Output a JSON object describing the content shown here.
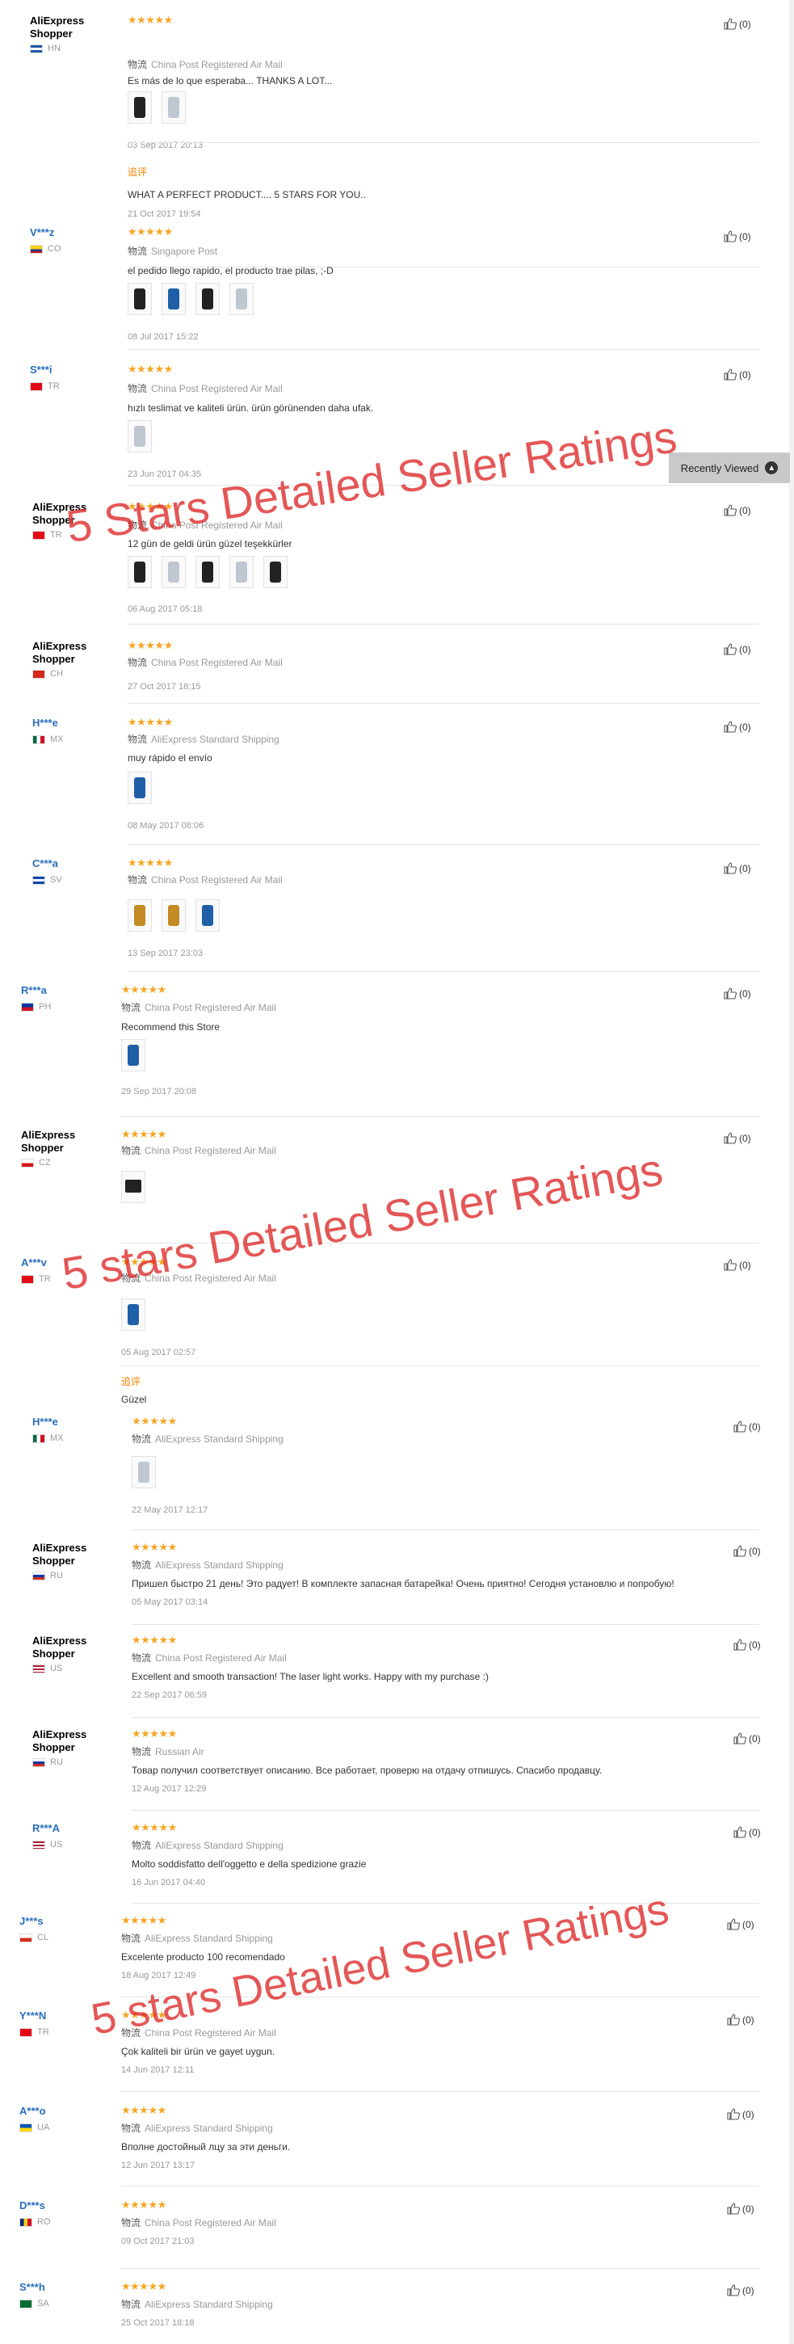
{
  "helpful_icon": "thumbs-up-icon",
  "star_glyph": "★★★★★",
  "recently_viewed": {
    "label": "Recently Viewed",
    "icon": "chevron-up-icon"
  },
  "watermarks": [
    {
      "text": "5 Stars Detailed Seller Ratings"
    },
    {
      "text": "5 stars Detailed Seller Ratings"
    },
    {
      "text": "5 stars Detailed Seller Ratings"
    }
  ],
  "reviews": [
    {
      "user": "AliExpress Shopper",
      "country": "HN",
      "flag": "hn",
      "stars": 5,
      "ship_zh": "物流",
      "shipping": "China Post Registered Air Mail",
      "text": "Es más de lo que esperaba... THANKS A LOT...",
      "photos": 2,
      "date": "03 Sep 2017 20:13",
      "helpful": "(0)",
      "followup_label": "追评",
      "followup_text": "WHAT A PERFECT PRODUCT.... 5 STARS FOR YOU..",
      "followup_date": "21 Oct 2017 19:54"
    },
    {
      "user": "V***z",
      "country": "CO",
      "flag": "co",
      "stars": 5,
      "ship_zh": "物流",
      "shipping": "Singapore Post",
      "text": "el pedido llego rapido, el producto trae pilas, ;-D",
      "photos": 4,
      "date": "08 Jul 2017 15:22",
      "helpful": "(0)"
    },
    {
      "user": "S***i",
      "country": "TR",
      "flag": "tr",
      "stars": 5,
      "ship_zh": "物流",
      "shipping": "China Post Registered Air Mail",
      "text": "hızlı teslimat ve kaliteli ürün. ürün görünenden daha ufak.",
      "photos": 1,
      "date": "23 Jun 2017 04:35",
      "helpful": "(0)"
    },
    {
      "user": "AliExpress Shopper",
      "country": "TR",
      "flag": "tr",
      "stars": 5,
      "ship_zh": "物流",
      "shipping": "China Post Registered Air Mail",
      "text": "12 gün de geldi ürün güzel teşekkürler",
      "photos": 5,
      "date": "06 Aug 2017 05:18",
      "helpful": "(0)"
    },
    {
      "user": "AliExpress Shopper",
      "country": "CH",
      "flag": "ch",
      "stars": 5,
      "ship_zh": "物流",
      "shipping": "China Post Registered Air Mail",
      "text": "",
      "photos": 0,
      "date": "27 Oct 2017 18:15",
      "helpful": "(0)"
    },
    {
      "user": "H***e",
      "country": "MX",
      "flag": "mx",
      "stars": 5,
      "ship_zh": "物流",
      "shipping": "AliExpress Standard Shipping",
      "text": "muy rápido el envío",
      "photos": 1,
      "date": "08 May 2017 08:06",
      "helpful": "(0)"
    },
    {
      "user": "C***a",
      "country": "SV",
      "flag": "sv",
      "stars": 5,
      "ship_zh": "物流",
      "shipping": "China Post Registered Air Mail",
      "text": "",
      "photos": 3,
      "date": "13 Sep 2017 23:03",
      "helpful": "(0)"
    },
    {
      "user": "R***a",
      "country": "PH",
      "flag": "ph",
      "stars": 5,
      "ship_zh": "物流",
      "shipping": "China Post Registered Air Mail",
      "text": "Recommend this Store",
      "photos": 1,
      "date": "29 Sep 2017 20:08",
      "helpful": "(0)"
    },
    {
      "user": "AliExpress Shopper",
      "country": "CZ",
      "flag": "cz",
      "stars": 5,
      "ship_zh": "物流",
      "shipping": "China Post Registered Air Mail",
      "text": "",
      "photos": 1,
      "date": "",
      "helpful": "(0)"
    },
    {
      "user": "A***v",
      "country": "TR",
      "flag": "tr",
      "stars": 5,
      "ship_zh": "物流",
      "shipping": "China Post Registered Air Mail",
      "text": "",
      "photos": 1,
      "date": "05 Aug 2017 02:57",
      "helpful": "(0)",
      "followup_label": "追评",
      "followup_text": "Güzel",
      "followup_date": ""
    },
    {
      "user": "H***e",
      "country": "MX",
      "flag": "mx",
      "stars": 5,
      "ship_zh": "物流",
      "shipping": "AliExpress Standard Shipping",
      "text": "",
      "photos": 1,
      "date": "22 May 2017 12:17",
      "helpful": "(0)"
    },
    {
      "user": "AliExpress Shopper",
      "country": "RU",
      "flag": "ru",
      "stars": 5,
      "ship_zh": "物流",
      "shipping": "AliExpress Standard Shipping",
      "text": "Пришел быстро 21 день! Это радует! В комплекте запасная батарейка! Очень приятно! Сегодня установлю и попробую!",
      "photos": 0,
      "date": "05 May 2017 03:14",
      "helpful": "(0)"
    },
    {
      "user": "AliExpress Shopper",
      "country": "US",
      "flag": "us",
      "stars": 5,
      "ship_zh": "物流",
      "shipping": "China Post Registered Air Mail",
      "text": "Excellent and smooth transaction! The laser light works. Happy with my purchase :)",
      "photos": 0,
      "date": "22 Sep 2017 06:59",
      "helpful": "(0)"
    },
    {
      "user": "AliExpress Shopper",
      "country": "RU",
      "flag": "ru",
      "stars": 5,
      "ship_zh": "物流",
      "shipping": "Russian Air",
      "text": "Товар получил соответствует описанию. Все работает, проверю на отдачу отпишусь. Спасибо продавцу.",
      "photos": 0,
      "date": "12 Aug 2017 12:29",
      "helpful": "(0)"
    },
    {
      "user": "R***A",
      "country": "US",
      "flag": "us",
      "stars": 5,
      "ship_zh": "物流",
      "shipping": "AliExpress Standard Shipping",
      "text": "Molto soddisfatto dell'oggetto e della spedizione grazie",
      "photos": 0,
      "date": "16 Jun 2017 04:40",
      "helpful": "(0)"
    },
    {
      "user": "J***s",
      "country": "CL",
      "flag": "cl",
      "stars": 5,
      "ship_zh": "物流",
      "shipping": "AliExpress Standard Shipping",
      "text": "Excelente producto 100 recomendado",
      "photos": 0,
      "date": "18 Aug 2017 12:49",
      "helpful": "(0)"
    },
    {
      "user": "Y***N",
      "country": "TR",
      "flag": "tr",
      "stars": 5,
      "ship_zh": "物流",
      "shipping": "China Post Registered Air Mail",
      "text": "Çok kaliteli bir ürün ve gayet uygun.",
      "photos": 0,
      "date": "14 Jun 2017 12:11",
      "helpful": "(0)"
    },
    {
      "user": "A***o",
      "country": "UA",
      "flag": "ua",
      "stars": 5,
      "ship_zh": "物流",
      "shipping": "AliExpress Standard Shipping",
      "text": "Вполне достойный лцу за эти деньги.",
      "photos": 0,
      "date": "12 Jun 2017 13:17",
      "helpful": "(0)"
    },
    {
      "user": "D***s",
      "country": "RO",
      "flag": "ro",
      "stars": 5,
      "ship_zh": "物流",
      "shipping": "China Post Registered Air Mail",
      "text": "",
      "photos": 0,
      "date": "09 Oct 2017 21:03",
      "helpful": "(0)"
    },
    {
      "user": "S***h",
      "country": "SA",
      "flag": "sa",
      "stars": 5,
      "ship_zh": "物流",
      "shipping": "AliExpress Standard Shipping",
      "text": "",
      "photos": 0,
      "date": "25 Oct 2017 18:18",
      "helpful": "(0)"
    }
  ]
}
